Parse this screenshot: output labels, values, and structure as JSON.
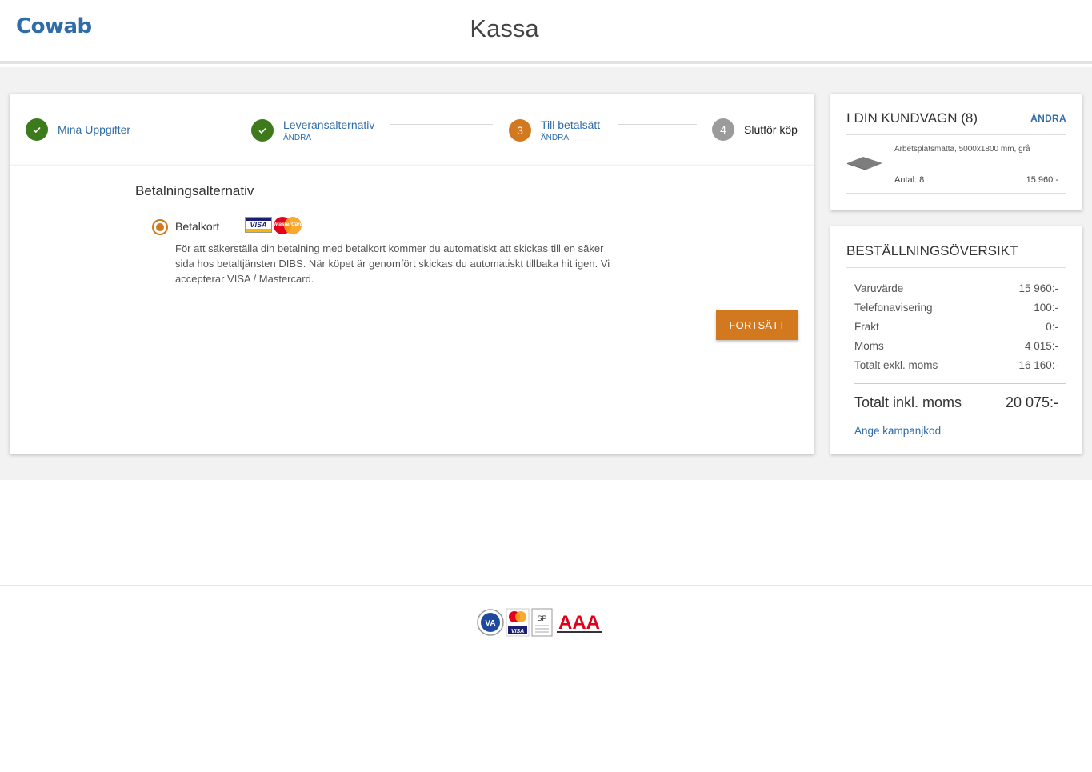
{
  "header": {
    "logo": "Cowab",
    "title": "Kassa"
  },
  "steps": [
    {
      "label": "Mina Uppgifter",
      "sub": "",
      "status": "done",
      "number": ""
    },
    {
      "label": "Leveransalternativ",
      "sub": "ÄNDRA",
      "status": "done",
      "number": ""
    },
    {
      "label": "Till betalsätt",
      "sub": "ÄNDRA",
      "status": "active",
      "number": "3"
    },
    {
      "label": "Slutför köp",
      "sub": "",
      "status": "todo",
      "number": "4"
    }
  ],
  "payment": {
    "title": "Betalningsalternativ",
    "option_label": "Betalkort",
    "card_logos": [
      "VISA",
      "MasterCard"
    ],
    "description": "För att säkerställa din betalning med betalkort kommer du automatiskt att skickas till en säker sida hos betaltjänsten DIBS. När köpet är genomfört skickas du automatiskt tillbaka hit igen. Vi accepterar VISA / Mastercard.",
    "continue_label": "FORTSÄTT"
  },
  "cart": {
    "title": "I DIN KUNDVAGN (8)",
    "edit_label": "ÄNDRA",
    "items": [
      {
        "name": "Arbetsplatsmatta, 5000x1800 mm, grå",
        "qty": "Antal: 8",
        "price": "15 960:-"
      }
    ]
  },
  "summary": {
    "title": "BESTÄLLNINGSÖVERSIKT",
    "rows": [
      {
        "label": "Varuvärde",
        "value": "15 960:-"
      },
      {
        "label": "Telefonavisering",
        "value": "100:-"
      },
      {
        "label": "Frakt",
        "value": "0:-"
      },
      {
        "label": "Moms",
        "value": "4 015:-"
      },
      {
        "label": "Totalt exkl. moms",
        "value": "16 160:-"
      }
    ],
    "total_label": "Totalt inkl. moms",
    "total_value": "20 075:-",
    "promo_label": "Ange kampanjkod"
  },
  "footer": {
    "badges": [
      "VA",
      "MasterCard",
      "VISA",
      "SP",
      "AAA"
    ]
  },
  "colors": {
    "accent": "#d2781f",
    "link": "#2f6ca8",
    "done": "#3d7a1b",
    "todo": "#9b9b9b"
  }
}
